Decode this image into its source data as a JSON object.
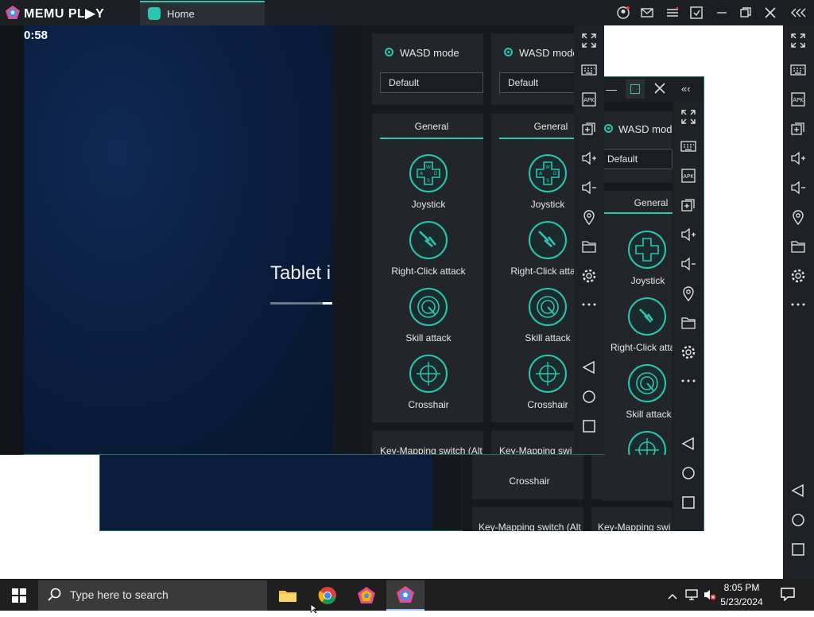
{
  "app": {
    "brand": "MEMU PL▶Y",
    "home_tab": "Home",
    "clock": "0:58"
  },
  "screen": {
    "tablet_text": "Tablet i",
    "progress": 0.83
  },
  "keymap_panel": {
    "mode_label": "WASD mode",
    "mode_label_clipped": "WASD mode",
    "preset": "Default",
    "section": "General",
    "tools": [
      {
        "label": "Joystick",
        "icon": "joystick-icon"
      },
      {
        "label": "Right-Click attack",
        "icon": "right-click-attack-icon"
      },
      {
        "label": "Skill attack",
        "icon": "skill-attack-icon"
      },
      {
        "label": "Crosshair",
        "icon": "crosshair-icon"
      }
    ],
    "switch_label": "Key-Mapping switch (Alt",
    "switch_label_short": "Key-Mapping swi"
  },
  "toolbar_icons": [
    "fullscreen-icon",
    "keyboard-icon",
    "apk-icon",
    "multi-window-icon",
    "volume-up-icon",
    "volume-down-icon",
    "location-icon",
    "folder-icon",
    "settings-icon",
    "more-icon",
    "back-icon",
    "home-icon",
    "recents-icon"
  ],
  "taskbar": {
    "search_placeholder": "Type here to search",
    "time": "8:05 PM",
    "date": "5/23/2024"
  },
  "colors": {
    "accent": "#29c6b0",
    "title_bar": "#1b1e22",
    "panel": "#22262b",
    "screen_bg": "#0a1c3c"
  }
}
